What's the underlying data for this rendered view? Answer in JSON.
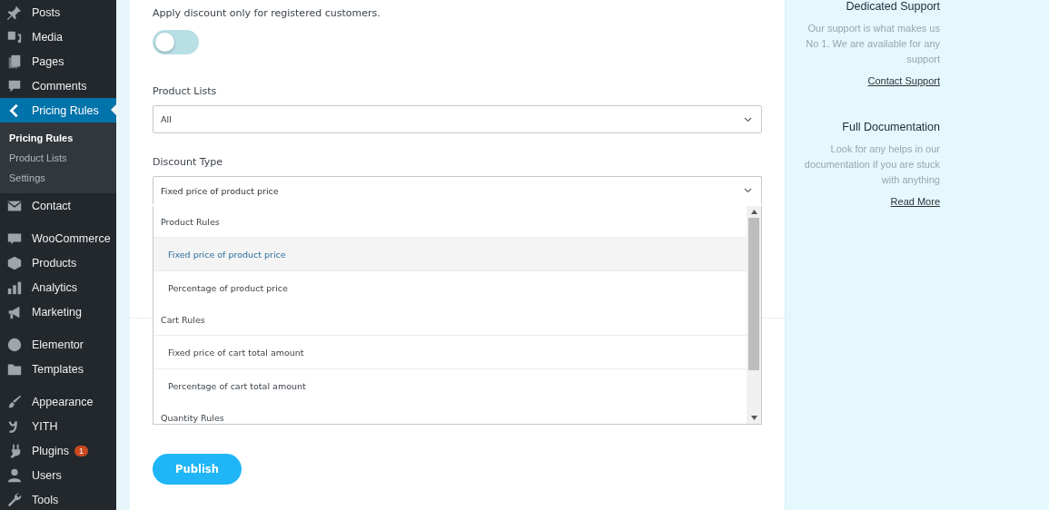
{
  "sidebar": {
    "groups": [
      {
        "items": [
          {
            "label": "Posts",
            "current": false
          },
          {
            "label": "Media",
            "current": false
          },
          {
            "label": "Pages",
            "current": false
          },
          {
            "label": "Comments",
            "current": false
          },
          {
            "label": "Pricing Rules",
            "current": true,
            "children": [
              {
                "label": "Pricing Rules",
                "selected": true
              },
              {
                "label": "Product Lists",
                "selected": false
              },
              {
                "label": "Settings",
                "selected": false
              }
            ]
          },
          {
            "label": "Contact",
            "current": false
          }
        ]
      },
      {
        "items": [
          {
            "label": "WooCommerce",
            "current": false
          },
          {
            "label": "Products",
            "current": false
          },
          {
            "label": "Analytics",
            "current": false
          },
          {
            "label": "Marketing",
            "current": false
          }
        ]
      },
      {
        "items": [
          {
            "label": "Elementor",
            "current": false
          },
          {
            "label": "Templates",
            "current": false
          }
        ]
      },
      {
        "items": [
          {
            "label": "Appearance",
            "current": false
          },
          {
            "label": "YITH",
            "current": false
          },
          {
            "label": "Plugins",
            "current": false,
            "badge": "1"
          },
          {
            "label": "Users",
            "current": false
          },
          {
            "label": "Tools",
            "current": false
          }
        ]
      }
    ]
  },
  "form": {
    "registered_only": {
      "label": "Apply discount only for registered customers.",
      "on": false
    },
    "product_lists": {
      "label": "Product Lists",
      "value": "All"
    },
    "discount_type": {
      "label": "Discount Type",
      "value": "Fixed price of product price",
      "open": true,
      "options": [
        {
          "kind": "group",
          "label": "Product Rules"
        },
        {
          "kind": "option",
          "label": "Fixed price of product price",
          "selected": true
        },
        {
          "kind": "option",
          "label": "Percentage of product price",
          "selected": false
        },
        {
          "kind": "group",
          "label": "Cart Rules"
        },
        {
          "kind": "option",
          "label": "Fixed price of cart total amount",
          "selected": false
        },
        {
          "kind": "option",
          "label": "Percentage of cart total amount",
          "selected": false
        },
        {
          "kind": "group",
          "label": "Quantity Rules"
        }
      ]
    },
    "publish_button": "Publish"
  },
  "aside": {
    "cards": [
      {
        "title": "Dedicated Support",
        "text": "Our support is what makes us No 1. We are available for any support",
        "link": "Contact Support"
      },
      {
        "title": "Full Documentation",
        "text": "Look for any helps in our documentation if you are stuck with anything",
        "link": "Read More"
      }
    ]
  }
}
